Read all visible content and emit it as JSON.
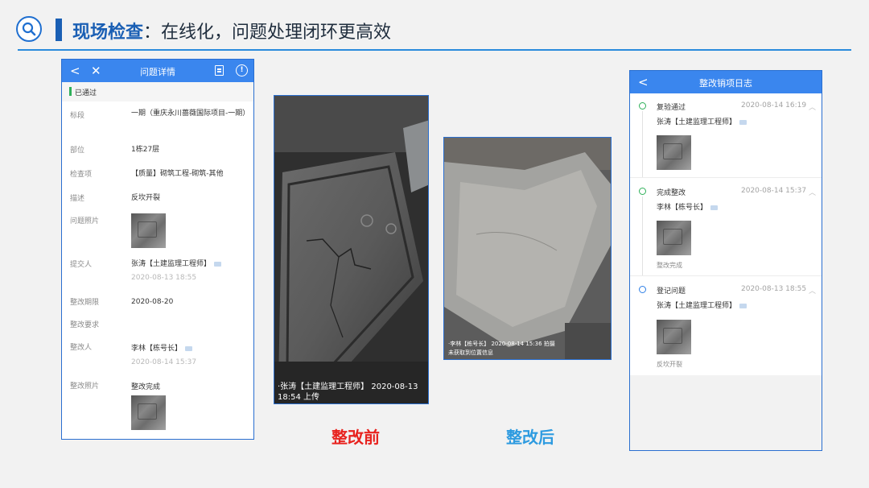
{
  "header": {
    "title_highlight": "现场检查",
    "title_rest": "：在线化，问题处理闭环更高效"
  },
  "issue_detail": {
    "nav_title": "问题详情",
    "status": "已通过",
    "fields": {
      "section_label": "标段",
      "section_value": "一期（重庆永川蔷薇国际项目-一期）",
      "location_label": "部位",
      "location_value": "1栋27层",
      "check_item_label": "检查项",
      "check_item_value": "【质量】砌筑工程-砌筑-其他",
      "desc_label": "描述",
      "desc_value": "反坎开裂",
      "photo_label": "问题照片",
      "submitter_label": "提交人",
      "submitter_value": "张涛【土建监理工程师】",
      "submitter_time": "2020-08-13 18:55",
      "deadline_label": "整改期限",
      "deadline_value": "2020-08-20",
      "requirement_label": "整改要求",
      "rectifier_label": "整改人",
      "rectifier_value": "李林【栋号长】",
      "rectifier_time": "2020-08-14 15:37",
      "rectify_photo_label": "整改照片",
      "rectify_photo_value": "整改完成"
    }
  },
  "photos": {
    "before_caption": "·张涛【土建监理工程师】 2020-08-13 18:54 上传",
    "after_caption_line1": "·李林【栋号长】 2020-08-14 15:36 拍摄",
    "after_caption_line2": "未获取到位置信息",
    "before_label": "整改前",
    "after_label": "整改后"
  },
  "log": {
    "nav_title": "整改销项日志",
    "entries": [
      {
        "title": "复验通过",
        "time": "2020-08-14 16:19",
        "user": "张涛【土建监理工程师】",
        "note": ""
      },
      {
        "title": "完成整改",
        "time": "2020-08-14 15:37",
        "user": "李林【栋号长】",
        "note": "整改完成"
      },
      {
        "title": "登记问题",
        "time": "2020-08-13 18:55",
        "user": "张涛【土建监理工程师】",
        "note": "反坎开裂"
      }
    ]
  },
  "colors": {
    "accent": "#1a5fb4",
    "nav_blue": "#3a86ee",
    "before_red": "#e8231f",
    "after_blue": "#2e9be0",
    "passed_green": "#2fb05a"
  },
  "icons": [
    "search-icon",
    "back-icon",
    "close-icon",
    "document-icon",
    "info-icon",
    "user-tag-icon",
    "chevron-up-icon"
  ]
}
